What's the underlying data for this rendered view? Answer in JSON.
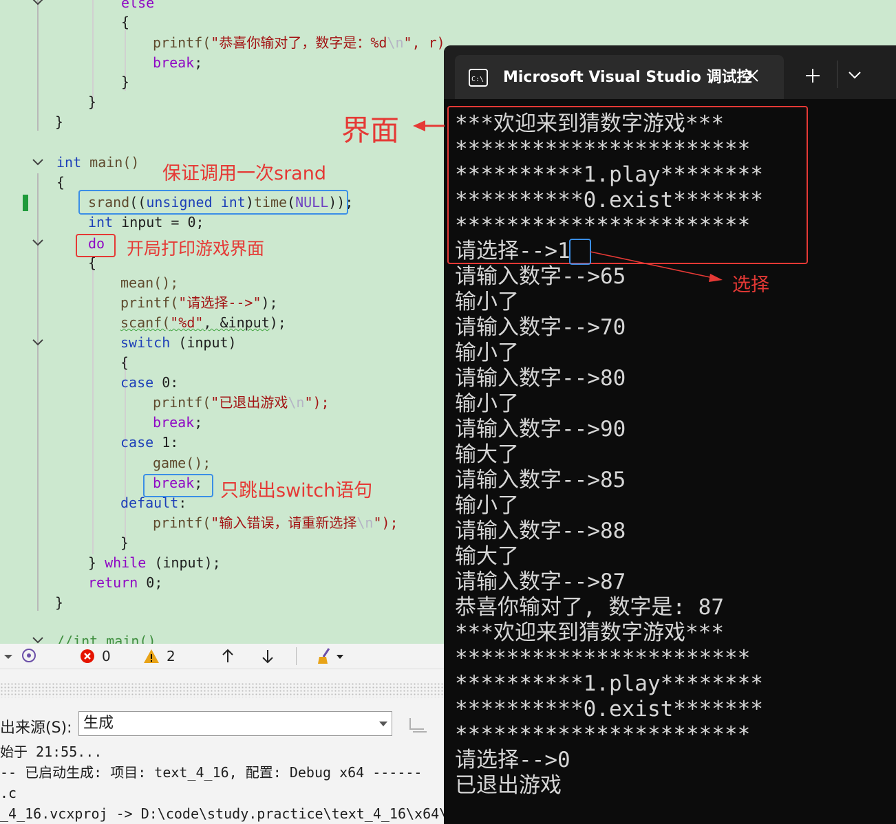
{
  "editor": {
    "lines": {
      "else_kw": "else",
      "open1": "{",
      "printf_win_fn": "printf(",
      "printf_win_str": "\"恭喜你输对了，数字是：%d",
      "printf_win_esc": "\\n",
      "printf_win_tail": "\", r);",
      "break1": "break",
      "semi": ";",
      "close1": "}",
      "close2": "}",
      "close3": "}",
      "int_kw": "int",
      "main_sig": "main()",
      "brace_open_main": "{",
      "srand_fn": "srand",
      "srand_p1": "((",
      "srand_unsigned": "unsigned",
      "srand_int": "int",
      "srand_p2": ")",
      "srand_time": "time",
      "srand_p3": "(",
      "srand_null": "NULL",
      "srand_p4": "));",
      "int_input_kw": "int",
      "int_input_rest": " input = 0;",
      "do_kw": "do",
      "do_brace": "{",
      "mean_call": "mean();",
      "printf_sel_fn": "printf(",
      "printf_sel_str": "\"请选择-->\"",
      "printf_sel_tail": ");",
      "scanf_fn": "scanf(",
      "scanf_str": "\"%d\"",
      "scanf_tail": ", &input",
      "scanf_end": ");",
      "switch_kw": "switch",
      "switch_rest": " (input)",
      "switch_brace": "{",
      "case0_kw": "case",
      "case0_rest": " 0:",
      "printf_exit_fn": "printf(",
      "printf_exit_str": "\"已退出游戏",
      "printf_exit_esc": "\\n",
      "printf_exit_tail": "\");",
      "break2": "break",
      "case1_kw": "case",
      "case1_rest": " 1:",
      "game_call": "game();",
      "break3": "break",
      "default_kw": "default",
      "default_colon": ":",
      "printf_err_fn": "printf(",
      "printf_err_str": "\"输入错误，请重新选择",
      "printf_err_esc": "\\n",
      "printf_err_tail": "\");",
      "switch_close": "}",
      "while_open": "} ",
      "while_kw": "while",
      "while_rest": " (input);",
      "return_kw": "return",
      "return_rest": " 0;",
      "main_close": "}",
      "comment_main": "//int main()"
    },
    "annotations": {
      "srand_note": "保证调用一次srand",
      "do_note": "开局打印游戏界面",
      "break_note": "只跳出switch语句",
      "ui_note": "界面",
      "select_note": "选择"
    }
  },
  "toolbar": {
    "errors_count": "0",
    "warnings_count": "2"
  },
  "output": {
    "source_label": "出来源(S):",
    "source_value": "生成",
    "lines": [
      "始于 21:55...",
      "-- 已启动生成: 项目: text_4_16, 配置: Debug x64 ------",
      ".c",
      "_4_16.vcxproj -> D:\\code\\study.practice\\text_4_16\\x64\\"
    ]
  },
  "console": {
    "tab_title": "Microsoft Visual Studio 调试控",
    "lines": [
      "***欢迎来到猜数字游戏***",
      "***********************",
      "**********1.play********",
      "**********0.exist*******",
      "***********************",
      "请选择-->1",
      "请输入数字-->65",
      "输小了",
      "请输入数字-->70",
      "输小了",
      "请输入数字-->80",
      "输小了",
      "请输入数字-->90",
      "输大了",
      "请输入数字-->85",
      "输小了",
      "请输入数字-->88",
      "输大了",
      "请输入数字-->87",
      "恭喜你输对了, 数字是: 87",
      "***欢迎来到猜数字游戏***",
      "***********************",
      "**********1.play********",
      "**********0.exist*******",
      "***********************",
      "请选择-->0",
      "已退出游戏"
    ]
  },
  "colors": {
    "editor_bg": "#cce8cf",
    "console_bg": "#0c0c0c",
    "annotation": "#e53935",
    "highlight_box": "#3a8ee6",
    "keyword": "#1d3fb8",
    "string": "#a31515"
  }
}
